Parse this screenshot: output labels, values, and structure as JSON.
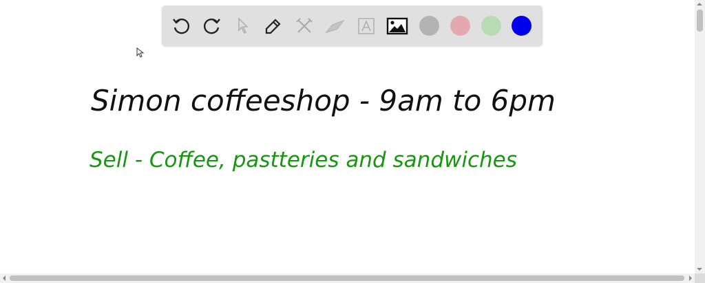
{
  "toolbar": {
    "tools": [
      {
        "icon": "undo-icon",
        "enabled": true
      },
      {
        "icon": "redo-icon",
        "enabled": true
      },
      {
        "icon": "select-pointer-icon",
        "enabled": false
      },
      {
        "icon": "pen-icon",
        "enabled": true
      },
      {
        "icon": "tools-icon",
        "enabled": false
      },
      {
        "icon": "eraser-icon",
        "enabled": false
      },
      {
        "icon": "text-icon",
        "enabled": false
      },
      {
        "icon": "image-icon",
        "enabled": true
      }
    ],
    "colors": [
      "#b3b3b3",
      "#e6a8b0",
      "#b7dbb4",
      "#0000ee"
    ]
  },
  "canvas": {
    "line1": {
      "text": "Simon coffeeshop - 9am to 6pm",
      "color": "#111111"
    },
    "line2": {
      "text": "Sell - Coffee, pastteries and sandwiches",
      "color": "#17960f"
    }
  }
}
